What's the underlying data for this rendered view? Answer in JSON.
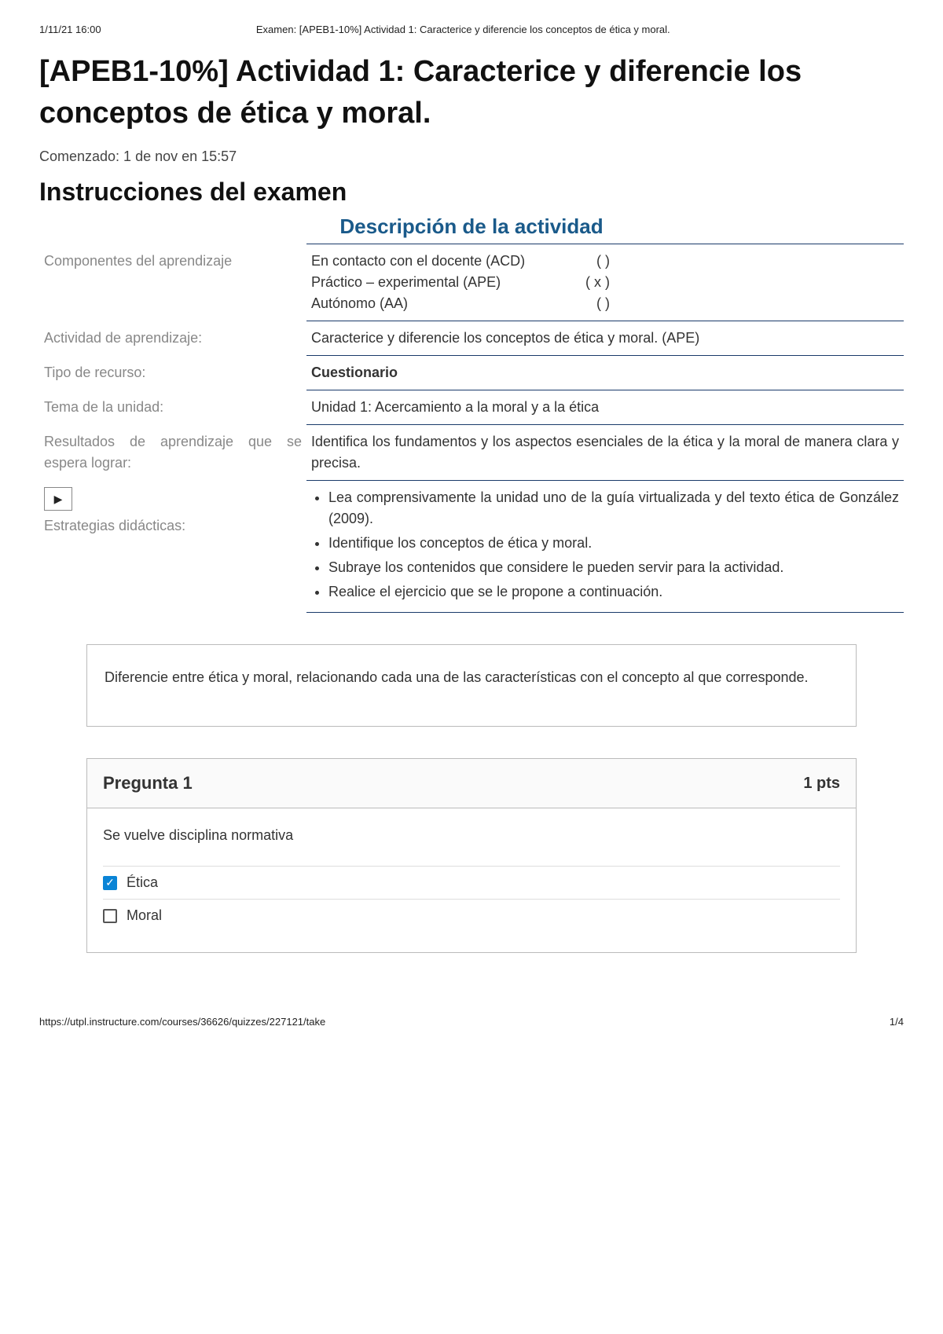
{
  "header": {
    "timestamp": "1/11/21 16:00",
    "doc_title": "Examen: [APEB1-10%] Actividad 1: Caracterice y diferencie los conceptos de ética y moral."
  },
  "page_title": "[APEB1-10%] Actividad 1: Caracterice y diferencie los conceptos de ética y moral.",
  "started_at": "Comenzado: 1 de nov en 15:57",
  "instructions_heading": "Instrucciones del examen",
  "description_heading": "Descripción de la actividad",
  "table": {
    "componentes_label": "Componentes del aprendizaje",
    "componentes": [
      {
        "name": "En contacto con el docente (ACD)",
        "mark": "(    )"
      },
      {
        "name": "Práctico – experimental (APE)",
        "mark": "( x )"
      },
      {
        "name": "Autónomo (AA)",
        "mark": "(    )"
      }
    ],
    "actividad_label": "Actividad de aprendizaje:",
    "actividad_value": "Caracterice y diferencie los conceptos de ética y moral. (APE)",
    "tipo_label": "Tipo de recurso:",
    "tipo_value": "Cuestionario",
    "tema_label": "Tema de la unidad:",
    "tema_value": "Unidad 1: Acercamiento a la moral y a la ética",
    "resultados_label": "Resultados de aprendizaje que se espera lograr:",
    "resultados_value": "Identifica los fundamentos y los aspectos esenciales de la ética y la moral de manera clara y precisa.",
    "estrategias_label": "Estrategias didácticas:",
    "estrategias": [
      "Lea comprensivamente la unidad uno de la guía virtualizada y del texto ética de González (2009).",
      "Identifique los conceptos de ética y moral.",
      "Subraye los contenidos que considere le pueden servir para la actividad.",
      "Realice el ejercicio que se le propone a continuación."
    ]
  },
  "question_intro": "Diferencie entre ética y moral, relacionando cada una de las características con el concepto al que corresponde.",
  "question1": {
    "title": "Pregunta 1",
    "points": "1 pts",
    "text": "Se vuelve disciplina normativa",
    "answers": [
      {
        "label": "Ética",
        "checked": true
      },
      {
        "label": "Moral",
        "checked": false
      }
    ]
  },
  "footer": {
    "url": "https://utpl.instructure.com/courses/36626/quizzes/227121/take",
    "page": "1/4"
  }
}
